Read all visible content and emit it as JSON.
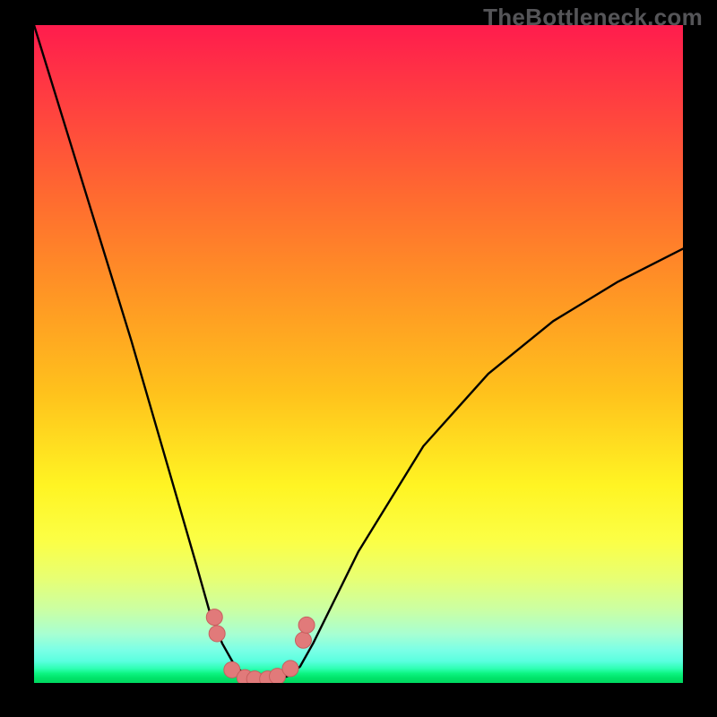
{
  "watermark": "TheBottleneck.com",
  "chart_data": {
    "type": "line",
    "title": "",
    "xlabel": "",
    "ylabel": "",
    "xlim": [
      0,
      100
    ],
    "ylim": [
      0,
      100
    ],
    "series": [
      {
        "name": "curve",
        "x": [
          0,
          5,
          10,
          15,
          20,
          25,
          27,
          29,
          31,
          33,
          35,
          37,
          39,
          41,
          43,
          50,
          60,
          70,
          80,
          90,
          100
        ],
        "values": [
          100,
          84,
          68,
          52,
          35,
          18,
          11,
          6,
          2.5,
          1,
          0.5,
          0.5,
          1,
          2.5,
          6,
          20,
          36,
          47,
          55,
          61,
          66
        ]
      },
      {
        "name": "marker-cluster",
        "x": [
          27.8,
          28.2,
          30.5,
          32.5,
          34.0,
          36.0,
          37.5,
          39.5,
          41.5,
          42.0
        ],
        "values": [
          10.0,
          7.5,
          2.0,
          0.8,
          0.6,
          0.6,
          1.0,
          2.2,
          6.5,
          8.8
        ]
      }
    ],
    "marker_color": "#e17a7a",
    "marker_stroke": "#c85f5f",
    "curve_color": "#000000",
    "background_gradient": {
      "top": "#ff1c4d",
      "mid": "#fff423",
      "bottom": "#00d860"
    }
  }
}
